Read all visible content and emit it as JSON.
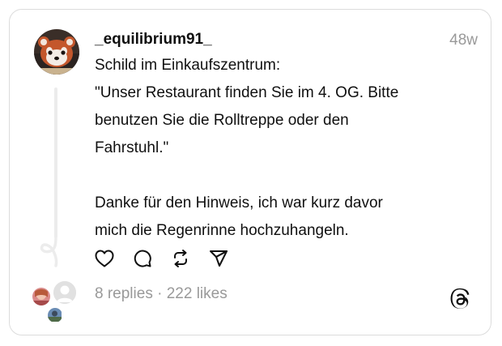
{
  "post": {
    "username": "_equilibrium91_",
    "timestamp": "48w",
    "text_lines_1": [
      "Schild im Einkaufszentrum:",
      "\"Unser Restaurant finden Sie im 4. OG. Bitte",
      "benutzen Sie die Rolltreppe oder den",
      "Fahrstuhl.\""
    ],
    "text_lines_2": [
      "Danke für den Hinweis, ich war kurz davor",
      "mich die Regenrinne hochzuhangeln."
    ]
  },
  "actions": {
    "icons": [
      "heart-icon",
      "comment-icon",
      "repost-icon",
      "share-icon"
    ]
  },
  "stats": {
    "replies": "8 replies",
    "separator": " · ",
    "likes": "222 likes"
  },
  "colors": {
    "text": "#101010",
    "muted": "#999999",
    "border": "#dcdcdc"
  }
}
